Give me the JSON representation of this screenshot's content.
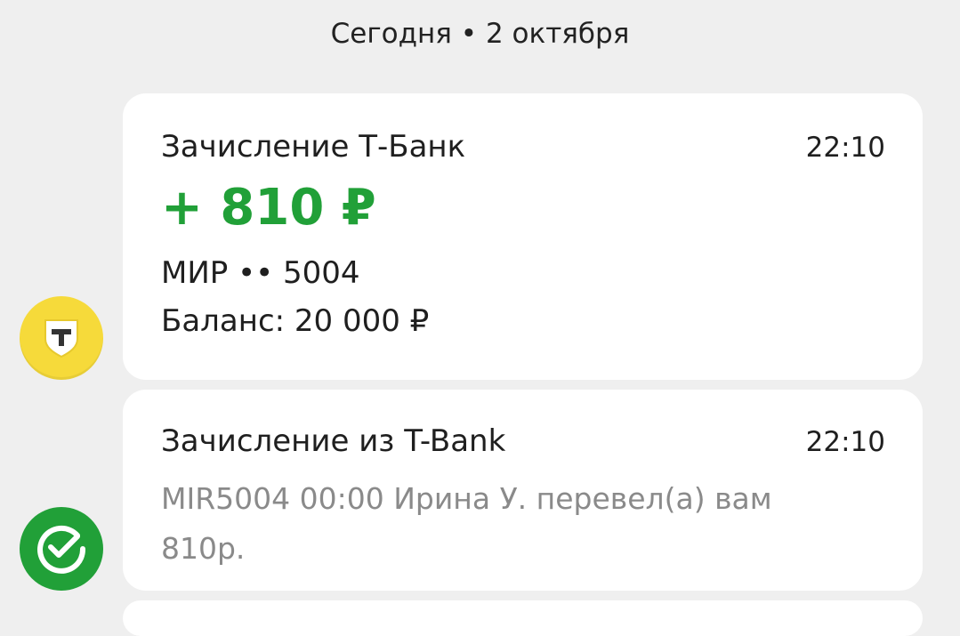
{
  "date_header": "Сегодня • 2 октября",
  "transactions": [
    {
      "title": "Зачисление Т-Банк",
      "time": "22:10",
      "amount": "+ 810 ₽",
      "card_info": "МИР •• 5004",
      "balance": "Баланс: 20 000 ₽",
      "icon": "tbank-shield-icon"
    },
    {
      "title": "Зачисление из T-Bank",
      "time": "22:10",
      "message": "MIR5004 00:00 Ирина У. перевел(а) вам 810р.",
      "icon": "sber-check-icon"
    }
  ],
  "colors": {
    "background": "#efefef",
    "card": "#ffffff",
    "amount_positive": "#21a038",
    "muted_text": "#8a8a8a",
    "tbank_yellow": "#f6da3a",
    "sber_green": "#21a038"
  }
}
